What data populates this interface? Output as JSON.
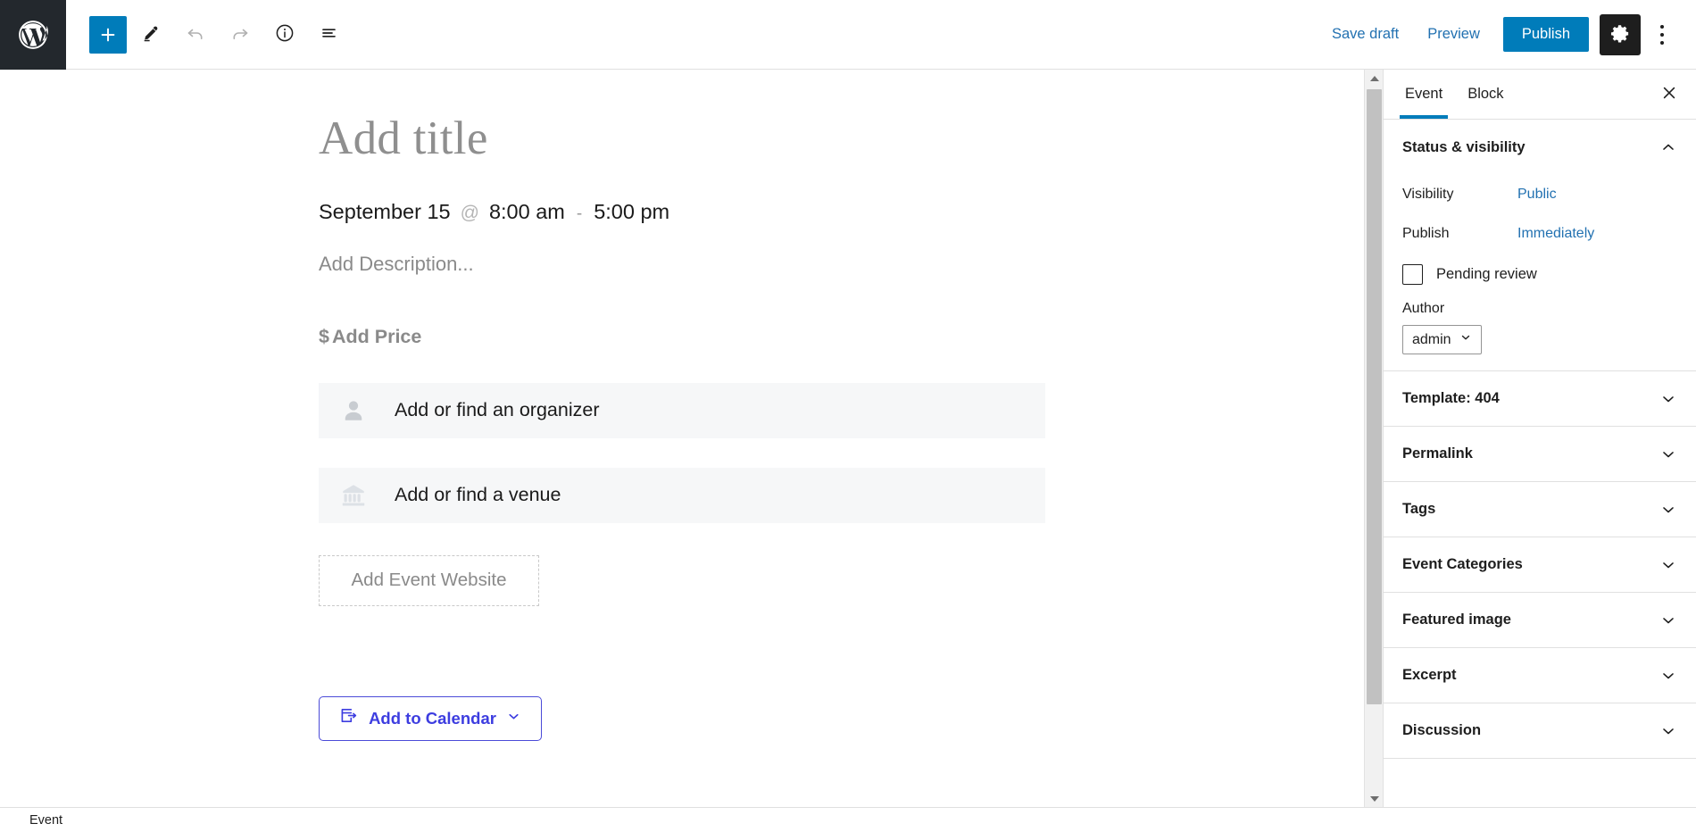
{
  "toolbar": {
    "logo_icon": "wordpress-logo",
    "add_block_label": "+",
    "buttons": [
      {
        "name": "add-block",
        "icon": "plus-icon"
      },
      {
        "name": "edit-tool",
        "icon": "pencil-icon"
      },
      {
        "name": "undo",
        "icon": "undo-arrow-icon"
      },
      {
        "name": "redo",
        "icon": "redo-arrow-icon"
      },
      {
        "name": "details",
        "icon": "info-circle-icon"
      },
      {
        "name": "list-view",
        "icon": "list-view-icon"
      }
    ],
    "save_draft_label": "Save draft",
    "preview_label": "Preview",
    "publish_label": "Publish",
    "settings_icon": "gear-icon",
    "more_options_icon": "kebab-menu-icon"
  },
  "editor": {
    "title_placeholder": "Add title",
    "date": "September 15",
    "at_symbol": "@",
    "start_time": "8:00 am",
    "time_separator": "-",
    "end_time": "5:00 pm",
    "description_placeholder": "Add Description...",
    "price_currency": "$",
    "price_placeholder": "Add Price",
    "organizer_placeholder": "Add or find an organizer",
    "organizer_icon": "person-icon",
    "venue_placeholder": "Add or find a venue",
    "venue_icon": "building-icon",
    "website_placeholder": "Add Event Website",
    "add_to_calendar_label": "Add to Calendar",
    "add_to_calendar_icon": "calendar-export-icon"
  },
  "sidebar": {
    "tabs": [
      {
        "label": "Event",
        "active": true
      },
      {
        "label": "Block",
        "active": false
      }
    ],
    "close_icon": "close-icon",
    "status_visibility": {
      "title": "Status & visibility",
      "chevron": "chevron-up-icon",
      "visibility_label": "Visibility",
      "visibility_value": "Public",
      "publish_label": "Publish",
      "publish_value": "Immediately",
      "pending_review_label": "Pending review",
      "pending_review_checked": false,
      "author_label": "Author",
      "author_value": "admin"
    },
    "panels": [
      {
        "title": "Template: 404",
        "chevron": "chevron-down-icon"
      },
      {
        "title": "Permalink",
        "chevron": "chevron-down-icon"
      },
      {
        "title": "Tags",
        "chevron": "chevron-down-icon"
      },
      {
        "title": "Event Categories",
        "chevron": "chevron-down-icon"
      },
      {
        "title": "Featured image",
        "chevron": "chevron-down-icon"
      },
      {
        "title": "Excerpt",
        "chevron": "chevron-down-icon"
      },
      {
        "title": "Discussion",
        "chevron": "chevron-down-icon"
      }
    ]
  },
  "statusbar": {
    "breadcrumb": "Event"
  },
  "colors": {
    "accent_blue": "#007cba",
    "link_blue": "#2271b1",
    "calendar_button": "#3d3de0",
    "dark_chrome": "#23282d",
    "field_bg": "#f6f7f8"
  }
}
